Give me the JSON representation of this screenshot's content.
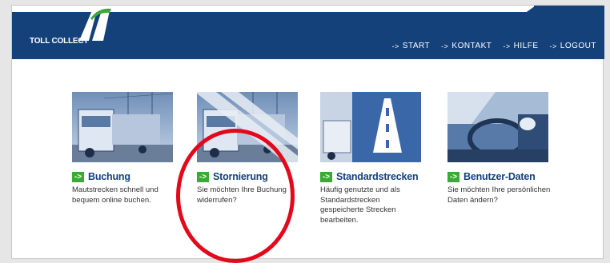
{
  "header": {
    "logo_text": "TOLL COLLECT",
    "nav": [
      {
        "label": "START"
      },
      {
        "label": "KONTAKT"
      },
      {
        "label": "HILFE"
      },
      {
        "label": "LOGOUT"
      }
    ],
    "nav_arrow": "->"
  },
  "cards": [
    {
      "title": "Buchung",
      "description": "Mautstrecken schnell und bequem online buchen.",
      "image": "truck-photo"
    },
    {
      "title": "Stornierung",
      "description": "Sie möchten Ihre Buchung widerrufen?",
      "image": "truck-photo-striped"
    },
    {
      "title": "Standardstrecken",
      "description": "Häufig genutzte und als Standardstrecken gespeicherte Strecken bearbeiten.",
      "image": "highway-sign-photo"
    },
    {
      "title": "Benutzer-Daten",
      "description": "Sie möchten Ihre persönlichen Daten ändern?",
      "image": "driver-photo"
    }
  ],
  "colors": {
    "header_blue": "#14417a",
    "arrow_green": "#3aa935",
    "annotation_red": "#e3081b"
  }
}
